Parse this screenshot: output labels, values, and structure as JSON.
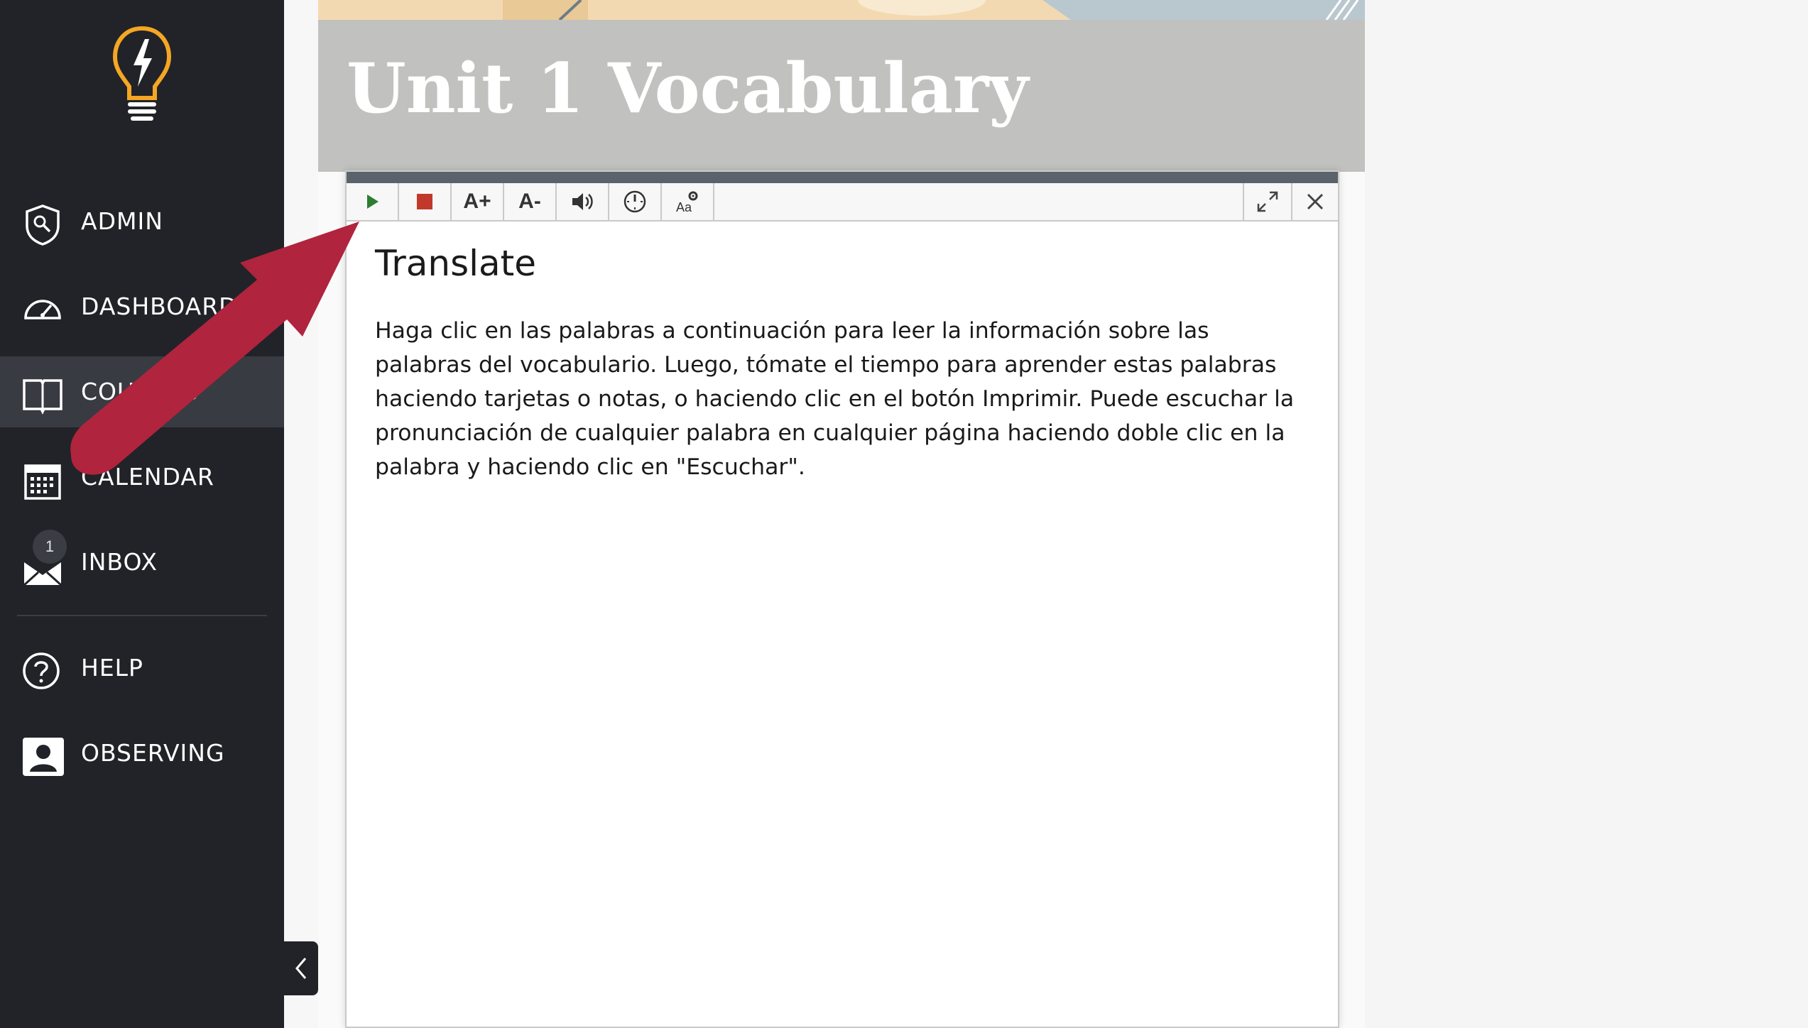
{
  "sidebar": {
    "items": [
      {
        "label": "ADMIN",
        "icon": "admin-shield-icon"
      },
      {
        "label": "DASHBOARD",
        "icon": "dashboard-gauge-icon"
      },
      {
        "label": "COURSES",
        "icon": "book-icon"
      },
      {
        "label": "CALENDAR",
        "icon": "calendar-icon"
      },
      {
        "label": "INBOX",
        "icon": "inbox-icon",
        "badge": "1"
      },
      {
        "label": "HELP",
        "icon": "help-icon"
      },
      {
        "label": "OBSERVING",
        "icon": "observer-icon"
      }
    ],
    "active": "COURSES"
  },
  "header": {
    "title": "Unit 1 Vocabulary"
  },
  "reader": {
    "toolbar": {
      "buttons": [
        "play",
        "stop",
        "font-increase",
        "font-decrease",
        "volume",
        "speed",
        "text-settings"
      ],
      "font_increase_label": "A+",
      "font_decrease_label": "A-",
      "settings_label": "Aa"
    },
    "heading": "Translate",
    "body": "Haga clic en las palabras a continuación para leer la información sobre las palabras del vocabulario. Luego, tómate el tiempo para aprender estas palabras haciendo tarjetas o notas, o haciendo clic en el botón Imprimir. Puede escuchar la pronunciación de cualquier palabra en cualquier página haciendo doble clic en la palabra y haciendo clic en \"Escuchar\"."
  },
  "colors": {
    "sidebar_bg": "#212328",
    "sidebar_active": "#383b41",
    "logo_accent": "#f5a623",
    "arrow": "#b0243e",
    "play": "#2e7d32",
    "stop": "#c0392b"
  }
}
